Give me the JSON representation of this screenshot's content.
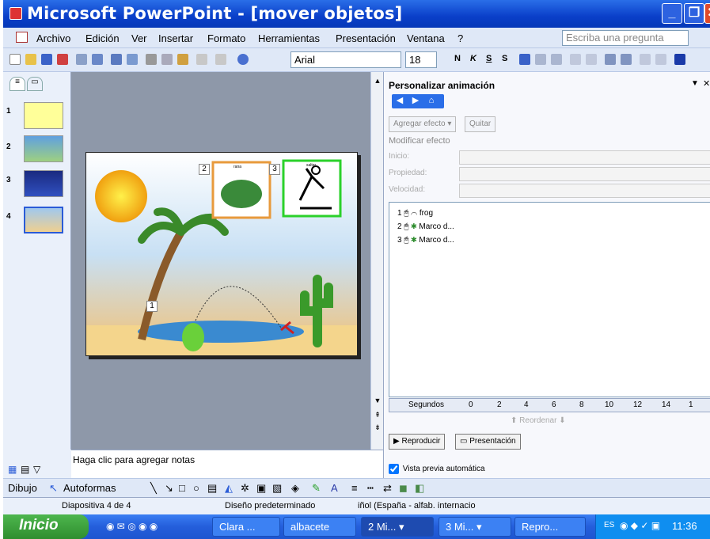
{
  "window": {
    "title": "Microsoft PowerPoint - [mover objetos]"
  },
  "menu": {
    "items": [
      "Archivo",
      "Edición",
      "Ver",
      "Insertar",
      "Formato",
      "Herramientas",
      "Presentación",
      "Ventana",
      "?"
    ],
    "ask_placeholder": "Escriba una pregunta"
  },
  "toolbar": {
    "font": "Arial",
    "size": "18",
    "bold": "N",
    "italic": "K",
    "underline": "S",
    "shadow": "S"
  },
  "slides_panel": {
    "numbers": [
      "1",
      "2",
      "3",
      "4"
    ],
    "selected": "4"
  },
  "slide": {
    "labels": [
      "2",
      "rana",
      "3",
      "saltar",
      "1"
    ]
  },
  "notes": {
    "placeholder": "Haga clic para agregar notas"
  },
  "task_pane": {
    "title": "Personalizar animación",
    "add_effect": "Agregar efecto",
    "remove": "Quitar",
    "modify_section": "Modificar efecto",
    "start_label": "Inicio:",
    "property_label": "Propiedad:",
    "speed_label": "Velocidad:",
    "animations": [
      {
        "num": "1",
        "name": "frog"
      },
      {
        "num": "2",
        "name": "Marco d..."
      },
      {
        "num": "3",
        "name": "Marco d..."
      }
    ],
    "timeline_label": "Segundos",
    "timeline_ticks": [
      "0",
      "2",
      "4",
      "6",
      "8",
      "10",
      "12",
      "14",
      "1"
    ],
    "reorder": "Reordenar",
    "play": "Reproducir",
    "slideshow": "Presentación",
    "preview_label": "Vista previa automática"
  },
  "draw_toolbar": {
    "draw": "Dibujo",
    "autoshapes": "Autoformas"
  },
  "status": {
    "slide": "Diapositiva 4 de 4",
    "design": "Diseño predeterminado",
    "language": "iñol (España - alfab. internacio"
  },
  "taskbar": {
    "start": "Inicio",
    "tasks": [
      "Clara ...",
      "albacete",
      "2 Mi...",
      "3 Mi...",
      "Repro..."
    ],
    "tray_lang": "ES",
    "clock": "11:36"
  },
  "colors": {
    "titlebar": "#0a3fc9",
    "taskbar": "#245edb",
    "start": "#2f8e2f",
    "frame_orange": "#e89a3c",
    "frame_green": "#2bd12b"
  }
}
